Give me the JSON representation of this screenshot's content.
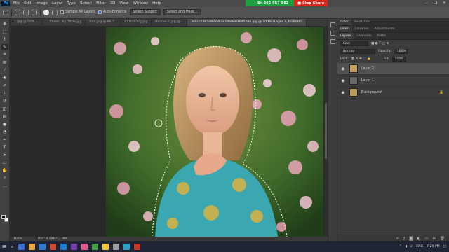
{
  "menubar": {
    "logo": "Ps",
    "items": [
      "File",
      "Edit",
      "Image",
      "Layer",
      "Type",
      "Select",
      "Filter",
      "3D",
      "View",
      "Window",
      "Help"
    ]
  },
  "session": {
    "id_label": "ID: 665-957-982",
    "stop_label": "Stop Share"
  },
  "window_controls": [
    "–",
    "❐",
    "✕"
  ],
  "options": {
    "sample_all_layers": "Sample All Layers",
    "auto_enhance": "Auto-Enhance",
    "select_subject": "Select Subject",
    "select_and_mask": "Select and Mask..."
  },
  "tabs": [
    "1.jpg @ 50% ...",
    "...ffower...by Tlttle.jpg",
    "tree.jpg @ 66.7...",
    "ODUDOVIJ.jpg",
    "Banner-2.jpg @...",
    "3c8cc0395d983883e14b9e816456de.jpg @ 100% (Layer 2, RGB/8#)"
  ],
  "statusbar": {
    "zoom": "100%",
    "doc": "Doc: 4.28M/12.9M"
  },
  "panels": {
    "top_tabs": [
      "Color",
      "Swatches"
    ],
    "mid_tabs": [
      "Learn",
      "Libraries",
      "Adjustments"
    ],
    "layer_tabs": [
      "Layers",
      "Channels",
      "Paths"
    ],
    "kind": "Kind",
    "blend_mode": "Normal",
    "opacity_label": "Opacity:",
    "opacity_value": "100%",
    "lock_label": "Lock:",
    "fill_label": "Fill:",
    "fill_value": "100%",
    "layers": [
      {
        "name": "Layer 2",
        "selected": true
      },
      {
        "name": "Layer 1",
        "selected": false
      },
      {
        "name": "Background",
        "selected": false
      }
    ]
  },
  "tray": {
    "lang": "ENG",
    "time": "7:29 PM"
  },
  "colors": {
    "accent": "#31a8ff",
    "session_green": "#1b9e3e",
    "stop_red": "#d9251c"
  }
}
